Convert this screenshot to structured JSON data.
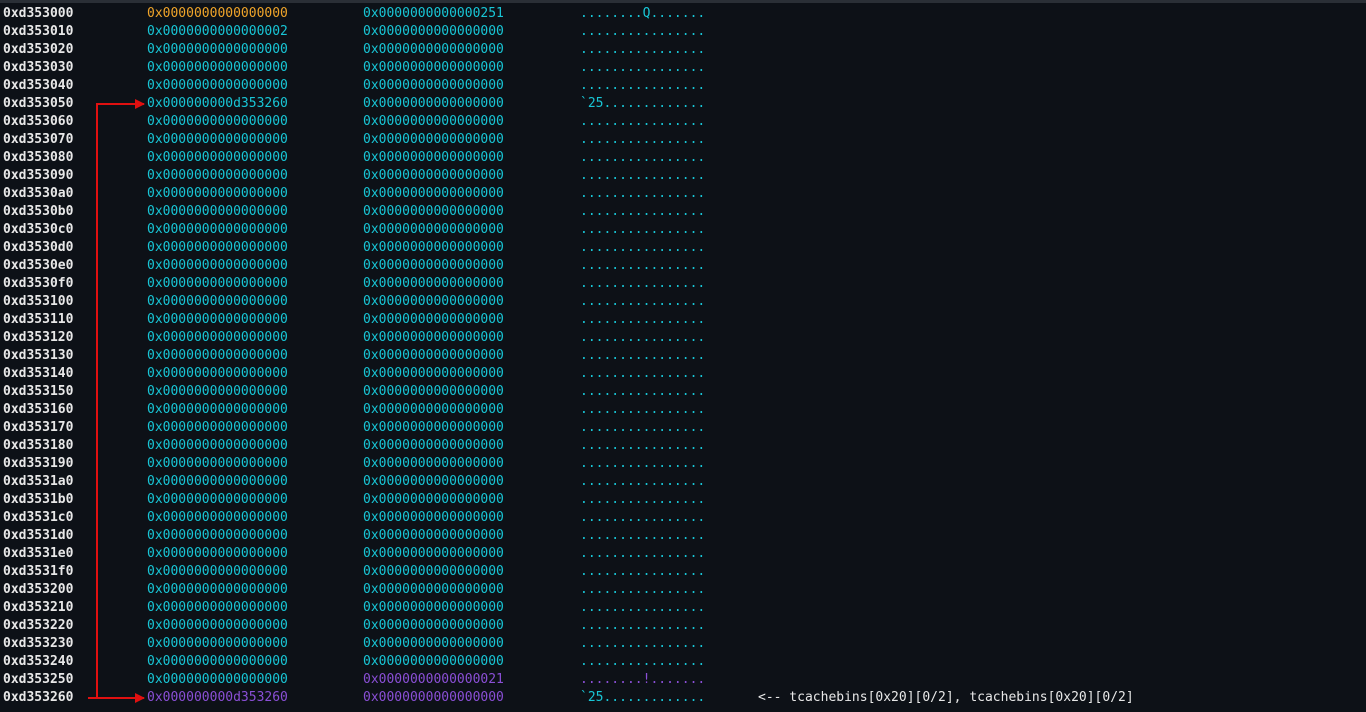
{
  "rows": [
    {
      "addr": "0xd353000",
      "q1": "0x0000000000000000",
      "q2": "0x0000000000000251",
      "ascii": "........Q.......",
      "c1": "yellow",
      "c2": "cyan",
      "ca": "cyan"
    },
    {
      "addr": "0xd353010",
      "q1": "0x0000000000000002",
      "q2": "0x0000000000000000",
      "ascii": "................",
      "c1": "cyan",
      "c2": "cyan",
      "ca": "cyan"
    },
    {
      "addr": "0xd353020",
      "q1": "0x0000000000000000",
      "q2": "0x0000000000000000",
      "ascii": "................",
      "c1": "cyan",
      "c2": "cyan",
      "ca": "cyan"
    },
    {
      "addr": "0xd353030",
      "q1": "0x0000000000000000",
      "q2": "0x0000000000000000",
      "ascii": "................",
      "c1": "cyan",
      "c2": "cyan",
      "ca": "cyan"
    },
    {
      "addr": "0xd353040",
      "q1": "0x0000000000000000",
      "q2": "0x0000000000000000",
      "ascii": "................",
      "c1": "cyan",
      "c2": "cyan",
      "ca": "cyan"
    },
    {
      "addr": "0xd353050",
      "q1": "0x000000000d353260",
      "q2": "0x0000000000000000",
      "ascii": "`25.............",
      "c1": "cyan",
      "c2": "cyan",
      "ca": "cyan"
    },
    {
      "addr": "0xd353060",
      "q1": "0x0000000000000000",
      "q2": "0x0000000000000000",
      "ascii": "................",
      "c1": "cyan",
      "c2": "cyan",
      "ca": "cyan"
    },
    {
      "addr": "0xd353070",
      "q1": "0x0000000000000000",
      "q2": "0x0000000000000000",
      "ascii": "................",
      "c1": "cyan",
      "c2": "cyan",
      "ca": "cyan"
    },
    {
      "addr": "0xd353080",
      "q1": "0x0000000000000000",
      "q2": "0x0000000000000000",
      "ascii": "................",
      "c1": "cyan",
      "c2": "cyan",
      "ca": "cyan"
    },
    {
      "addr": "0xd353090",
      "q1": "0x0000000000000000",
      "q2": "0x0000000000000000",
      "ascii": "................",
      "c1": "cyan",
      "c2": "cyan",
      "ca": "cyan"
    },
    {
      "addr": "0xd3530a0",
      "q1": "0x0000000000000000",
      "q2": "0x0000000000000000",
      "ascii": "................",
      "c1": "cyan",
      "c2": "cyan",
      "ca": "cyan"
    },
    {
      "addr": "0xd3530b0",
      "q1": "0x0000000000000000",
      "q2": "0x0000000000000000",
      "ascii": "................",
      "c1": "cyan",
      "c2": "cyan",
      "ca": "cyan"
    },
    {
      "addr": "0xd3530c0",
      "q1": "0x0000000000000000",
      "q2": "0x0000000000000000",
      "ascii": "................",
      "c1": "cyan",
      "c2": "cyan",
      "ca": "cyan"
    },
    {
      "addr": "0xd3530d0",
      "q1": "0x0000000000000000",
      "q2": "0x0000000000000000",
      "ascii": "................",
      "c1": "cyan",
      "c2": "cyan",
      "ca": "cyan"
    },
    {
      "addr": "0xd3530e0",
      "q1": "0x0000000000000000",
      "q2": "0x0000000000000000",
      "ascii": "................",
      "c1": "cyan",
      "c2": "cyan",
      "ca": "cyan"
    },
    {
      "addr": "0xd3530f0",
      "q1": "0x0000000000000000",
      "q2": "0x0000000000000000",
      "ascii": "................",
      "c1": "cyan",
      "c2": "cyan",
      "ca": "cyan"
    },
    {
      "addr": "0xd353100",
      "q1": "0x0000000000000000",
      "q2": "0x0000000000000000",
      "ascii": "................",
      "c1": "cyan",
      "c2": "cyan",
      "ca": "cyan"
    },
    {
      "addr": "0xd353110",
      "q1": "0x0000000000000000",
      "q2": "0x0000000000000000",
      "ascii": "................",
      "c1": "cyan",
      "c2": "cyan",
      "ca": "cyan"
    },
    {
      "addr": "0xd353120",
      "q1": "0x0000000000000000",
      "q2": "0x0000000000000000",
      "ascii": "................",
      "c1": "cyan",
      "c2": "cyan",
      "ca": "cyan"
    },
    {
      "addr": "0xd353130",
      "q1": "0x0000000000000000",
      "q2": "0x0000000000000000",
      "ascii": "................",
      "c1": "cyan",
      "c2": "cyan",
      "ca": "cyan"
    },
    {
      "addr": "0xd353140",
      "q1": "0x0000000000000000",
      "q2": "0x0000000000000000",
      "ascii": "................",
      "c1": "cyan",
      "c2": "cyan",
      "ca": "cyan"
    },
    {
      "addr": "0xd353150",
      "q1": "0x0000000000000000",
      "q2": "0x0000000000000000",
      "ascii": "................",
      "c1": "cyan",
      "c2": "cyan",
      "ca": "cyan"
    },
    {
      "addr": "0xd353160",
      "q1": "0x0000000000000000",
      "q2": "0x0000000000000000",
      "ascii": "................",
      "c1": "cyan",
      "c2": "cyan",
      "ca": "cyan"
    },
    {
      "addr": "0xd353170",
      "q1": "0x0000000000000000",
      "q2": "0x0000000000000000",
      "ascii": "................",
      "c1": "cyan",
      "c2": "cyan",
      "ca": "cyan"
    },
    {
      "addr": "0xd353180",
      "q1": "0x0000000000000000",
      "q2": "0x0000000000000000",
      "ascii": "................",
      "c1": "cyan",
      "c2": "cyan",
      "ca": "cyan"
    },
    {
      "addr": "0xd353190",
      "q1": "0x0000000000000000",
      "q2": "0x0000000000000000",
      "ascii": "................",
      "c1": "cyan",
      "c2": "cyan",
      "ca": "cyan"
    },
    {
      "addr": "0xd3531a0",
      "q1": "0x0000000000000000",
      "q2": "0x0000000000000000",
      "ascii": "................",
      "c1": "cyan",
      "c2": "cyan",
      "ca": "cyan"
    },
    {
      "addr": "0xd3531b0",
      "q1": "0x0000000000000000",
      "q2": "0x0000000000000000",
      "ascii": "................",
      "c1": "cyan",
      "c2": "cyan",
      "ca": "cyan"
    },
    {
      "addr": "0xd3531c0",
      "q1": "0x0000000000000000",
      "q2": "0x0000000000000000",
      "ascii": "................",
      "c1": "cyan",
      "c2": "cyan",
      "ca": "cyan"
    },
    {
      "addr": "0xd3531d0",
      "q1": "0x0000000000000000",
      "q2": "0x0000000000000000",
      "ascii": "................",
      "c1": "cyan",
      "c2": "cyan",
      "ca": "cyan"
    },
    {
      "addr": "0xd3531e0",
      "q1": "0x0000000000000000",
      "q2": "0x0000000000000000",
      "ascii": "................",
      "c1": "cyan",
      "c2": "cyan",
      "ca": "cyan"
    },
    {
      "addr": "0xd3531f0",
      "q1": "0x0000000000000000",
      "q2": "0x0000000000000000",
      "ascii": "................",
      "c1": "cyan",
      "c2": "cyan",
      "ca": "cyan"
    },
    {
      "addr": "0xd353200",
      "q1": "0x0000000000000000",
      "q2": "0x0000000000000000",
      "ascii": "................",
      "c1": "cyan",
      "c2": "cyan",
      "ca": "cyan"
    },
    {
      "addr": "0xd353210",
      "q1": "0x0000000000000000",
      "q2": "0x0000000000000000",
      "ascii": "................",
      "c1": "cyan",
      "c2": "cyan",
      "ca": "cyan"
    },
    {
      "addr": "0xd353220",
      "q1": "0x0000000000000000",
      "q2": "0x0000000000000000",
      "ascii": "................",
      "c1": "cyan",
      "c2": "cyan",
      "ca": "cyan"
    },
    {
      "addr": "0xd353230",
      "q1": "0x0000000000000000",
      "q2": "0x0000000000000000",
      "ascii": "................",
      "c1": "cyan",
      "c2": "cyan",
      "ca": "cyan"
    },
    {
      "addr": "0xd353240",
      "q1": "0x0000000000000000",
      "q2": "0x0000000000000000",
      "ascii": "................",
      "c1": "cyan",
      "c2": "cyan",
      "ca": "cyan"
    },
    {
      "addr": "0xd353250",
      "q1": "0x0000000000000000",
      "q2": "0x0000000000000021",
      "ascii": "........!.......",
      "c1": "cyan",
      "c2": "purple",
      "ca": "purple"
    },
    {
      "addr": "0xd353260",
      "q1": "0x000000000d353260",
      "q2": "0x0000000000000000",
      "ascii": "`25.............",
      "c1": "purple",
      "c2": "purple",
      "ca": "cyan",
      "note": "<-- tcachebins[0x20][0/2], tcachebins[0x20][0/2]"
    }
  ],
  "arrow": {
    "from_row": 38,
    "to_row": 5,
    "color": "#e01010"
  },
  "colors": {
    "background": "#0d1117",
    "cyan": "#18c6d6",
    "yellow": "#f0a52a",
    "purple": "#8a4fd6",
    "address": "#e8e8e8"
  }
}
